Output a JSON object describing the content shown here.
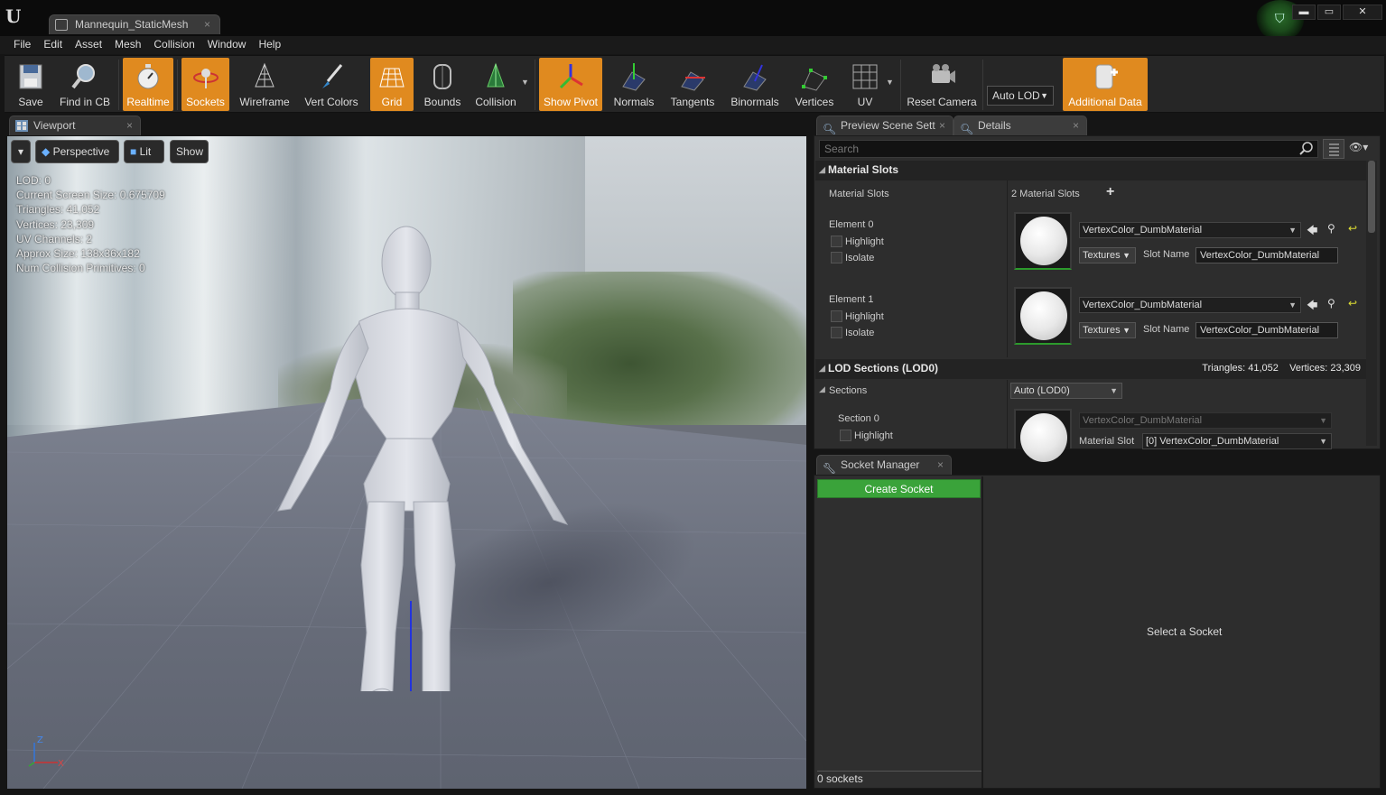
{
  "window": {
    "tab_title": "Mannequin_StaticMesh",
    "close_glyph": "×",
    "minimize": "▬",
    "maximize": "▭",
    "close": "✕"
  },
  "menu": [
    "File",
    "Edit",
    "Asset",
    "Mesh",
    "Collision",
    "Window",
    "Help"
  ],
  "toolbar": {
    "save": "Save",
    "find_in_cb": "Find in CB",
    "realtime": "Realtime",
    "sockets": "Sockets",
    "wireframe": "Wireframe",
    "vert_colors": "Vert Colors",
    "grid": "Grid",
    "bounds": "Bounds",
    "collision": "Collision",
    "show_pivot": "Show Pivot",
    "normals": "Normals",
    "tangents": "Tangents",
    "binormals": "Binormals",
    "vertices": "Vertices",
    "uv": "UV",
    "reset_camera": "Reset Camera",
    "auto_lod": "Auto LOD",
    "additional_data": "Additional Data",
    "accent_color": "#e08a1f"
  },
  "viewport": {
    "tab_label": "Viewport",
    "perspective": "Perspective",
    "lit": "Lit",
    "show": "Show",
    "stats": [
      "LOD:  0",
      "Current Screen Size:  0.675709",
      "Triangles:  41,052",
      "Vertices:  23,309",
      "UV Channels:  2",
      "Approx Size: 138x36x182",
      "Num Collision Primitives:  0"
    ],
    "axis_z": "Z",
    "axis_x": "X"
  },
  "details": {
    "preview_tab": "Preview Scene Sett",
    "details_tab": "Details",
    "search_placeholder": "Search",
    "material_slots_header": "Material Slots",
    "material_slots_label": "Material Slots",
    "material_slots_count": "2 Material Slots",
    "elements": [
      {
        "name": "Element 0",
        "highlight": "Highlight",
        "isolate": "Isolate",
        "material": "VertexColor_DumbMaterial",
        "textures": "Textures",
        "slot_name_label": "Slot Name",
        "slot_name": "VertexColor_DumbMaterial"
      },
      {
        "name": "Element 1",
        "highlight": "Highlight",
        "isolate": "Isolate",
        "material": "VertexColor_DumbMaterial",
        "textures": "Textures",
        "slot_name_label": "Slot Name",
        "slot_name": "VertexColor_DumbMaterial"
      }
    ],
    "lod_header": "LOD Sections (LOD0)",
    "lod_stats": "Triangles: 41,052    Vertices: 23,309",
    "sections_label": "Sections",
    "sections_value": "Auto (LOD0)",
    "section0": {
      "name": "Section 0",
      "highlight": "Highlight",
      "material": "VertexColor_DumbMaterial",
      "material_slot_label": "Material Slot",
      "material_slot_value": "[0] VertexColor_DumbMaterial"
    }
  },
  "sockets": {
    "tab_label": "Socket Manager",
    "create_button": "Create Socket",
    "count": "0 sockets",
    "empty_message": "Select a Socket",
    "button_color": "#3aa33a"
  }
}
